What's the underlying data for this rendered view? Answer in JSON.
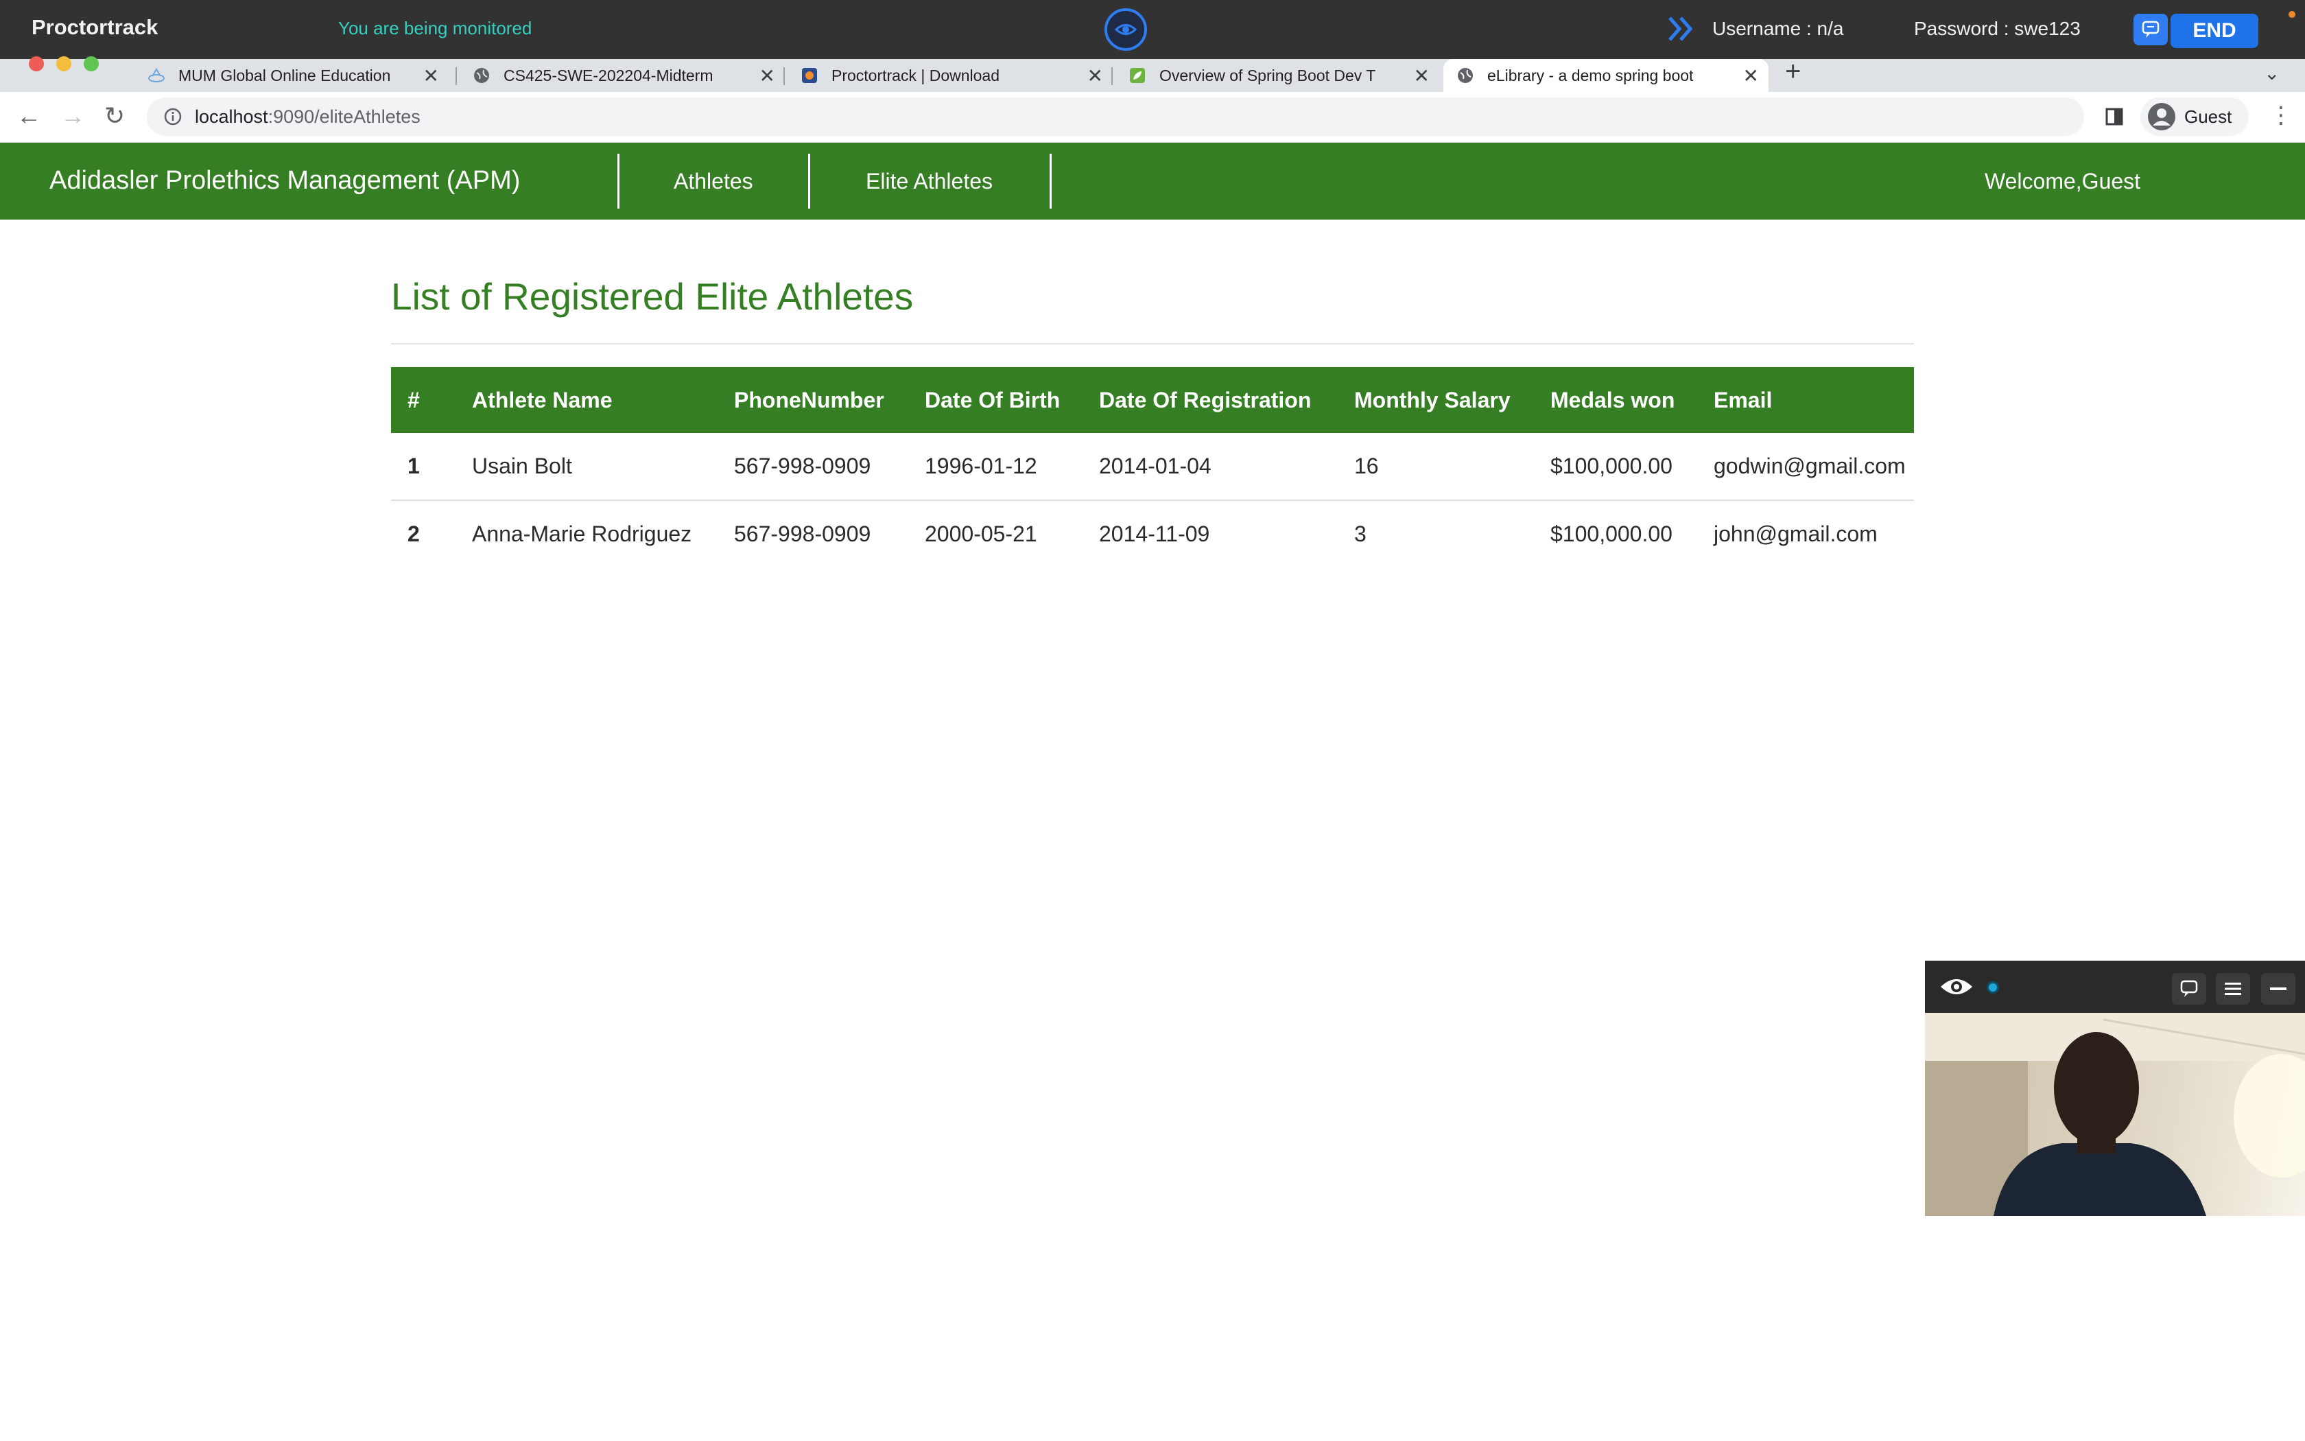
{
  "proctor": {
    "brand": "Proctortrack",
    "status": "You are being monitored",
    "username": "Username : n/a",
    "password": "Password : swe123",
    "end_label": "END"
  },
  "browser": {
    "tabs": [
      {
        "title": "MUM Global Online Education",
        "icon": "graduation-icon"
      },
      {
        "title": "CS425-SWE-202204-Midterm",
        "icon": "globe-icon"
      },
      {
        "title": "Proctortrack | Download",
        "icon": "proctortrack-icon"
      },
      {
        "title": "Overview of Spring Boot Dev T",
        "icon": "spring-leaf-icon"
      },
      {
        "title": "eLibrary - a demo spring boot",
        "icon": "globe-icon"
      }
    ],
    "url_host": "localhost",
    "url_path": ":9090/eliteAthletes",
    "profile_label": "Guest"
  },
  "app": {
    "brand": "Adidasler Prolethics Management (APM)",
    "nav": [
      "Athletes",
      "Elite Athletes"
    ],
    "welcome": "Welcome,Guest"
  },
  "page": {
    "title": "List of Registered Elite Athletes",
    "columns": [
      "#",
      "Athlete Name",
      "PhoneNumber",
      "Date Of Birth",
      "Date Of Registration",
      "Monthly Salary",
      "Medals won",
      "Email"
    ],
    "rows": [
      [
        "1",
        "Usain Bolt",
        "567-998-0909",
        "1996-01-12",
        "2014-01-04",
        "16",
        "$100,000.00",
        "godwin@gmail.com"
      ],
      [
        "2",
        "Anna-Marie Rodriguez",
        "567-998-0909",
        "2000-05-21",
        "2014-11-09",
        "3",
        "$100,000.00",
        "john@gmail.com"
      ]
    ]
  },
  "colors": {
    "brand_green": "#357e24",
    "proctor_bar": "#323232",
    "accent_blue": "#1f72e8",
    "monitor_text": "#35d0c0"
  }
}
